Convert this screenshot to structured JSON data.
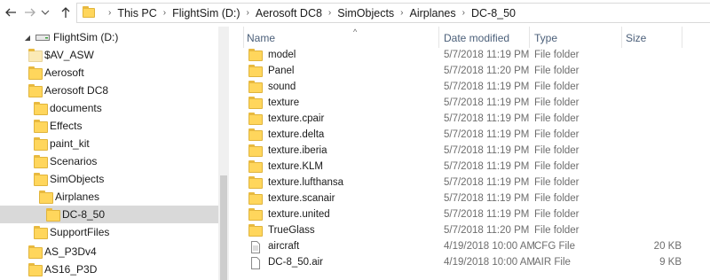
{
  "address": {
    "crumbs": [
      "This PC",
      "FlightSim (D:)",
      "Aerosoft DC8",
      "SimObjects",
      "Airplanes",
      "DC-8_50"
    ]
  },
  "tree": {
    "items": [
      {
        "label": "FlightSim (D:)",
        "icon": "drive-icon",
        "expander": "down"
      },
      {
        "label": "$AV_ASW",
        "icon": "folder-light-icon",
        "expander": ""
      },
      {
        "label": "Aerosoft",
        "icon": "folder-icon",
        "expander": ""
      },
      {
        "label": "Aerosoft DC8",
        "icon": "folder-icon",
        "expander": ""
      },
      {
        "label": "documents",
        "icon": "folder-icon",
        "expander": ""
      },
      {
        "label": "Effects",
        "icon": "folder-icon",
        "expander": ""
      },
      {
        "label": "paint_kit",
        "icon": "folder-icon",
        "expander": ""
      },
      {
        "label": "Scenarios",
        "icon": "folder-icon",
        "expander": ""
      },
      {
        "label": "SimObjects",
        "icon": "folder-icon",
        "expander": ""
      },
      {
        "label": "Airplanes",
        "icon": "folder-icon",
        "expander": ""
      },
      {
        "label": "DC-8_50",
        "icon": "folder-icon",
        "expander": "",
        "selected": true
      },
      {
        "label": "SupportFiles",
        "icon": "folder-icon",
        "expander": ""
      },
      {
        "label": "AS_P3Dv4",
        "icon": "folder-icon",
        "expander": ""
      },
      {
        "label": "AS16_P3D",
        "icon": "folder-icon",
        "expander": ""
      }
    ]
  },
  "columns": {
    "name": "Name",
    "date": "Date modified",
    "type": "Type",
    "size": "Size"
  },
  "files": [
    {
      "name": "model",
      "date": "5/7/2018 11:19 PM",
      "type": "File folder",
      "size": "",
      "icon": "folder-icon"
    },
    {
      "name": "Panel",
      "date": "5/7/2018 11:20 PM",
      "type": "File folder",
      "size": "",
      "icon": "folder-icon"
    },
    {
      "name": "sound",
      "date": "5/7/2018 11:19 PM",
      "type": "File folder",
      "size": "",
      "icon": "folder-icon"
    },
    {
      "name": "texture",
      "date": "5/7/2018 11:19 PM",
      "type": "File folder",
      "size": "",
      "icon": "folder-icon"
    },
    {
      "name": "texture.cpair",
      "date": "5/7/2018 11:19 PM",
      "type": "File folder",
      "size": "",
      "icon": "folder-icon"
    },
    {
      "name": "texture.delta",
      "date": "5/7/2018 11:19 PM",
      "type": "File folder",
      "size": "",
      "icon": "folder-icon"
    },
    {
      "name": "texture.iberia",
      "date": "5/7/2018 11:19 PM",
      "type": "File folder",
      "size": "",
      "icon": "folder-icon"
    },
    {
      "name": "texture.KLM",
      "date": "5/7/2018 11:19 PM",
      "type": "File folder",
      "size": "",
      "icon": "folder-icon"
    },
    {
      "name": "texture.lufthansa",
      "date": "5/7/2018 11:19 PM",
      "type": "File folder",
      "size": "",
      "icon": "folder-icon"
    },
    {
      "name": "texture.scanair",
      "date": "5/7/2018 11:19 PM",
      "type": "File folder",
      "size": "",
      "icon": "folder-icon"
    },
    {
      "name": "texture.united",
      "date": "5/7/2018 11:19 PM",
      "type": "File folder",
      "size": "",
      "icon": "folder-icon"
    },
    {
      "name": "TrueGlass",
      "date": "5/7/2018 11:20 PM",
      "type": "File folder",
      "size": "",
      "icon": "folder-icon"
    },
    {
      "name": "aircraft",
      "date": "4/19/2018 10:00 AM",
      "type": "CFG File",
      "size": "20 KB",
      "icon": "document-icon"
    },
    {
      "name": "DC-8_50.air",
      "date": "4/19/2018 10:00 AM",
      "type": "AIR File",
      "size": "9 KB",
      "icon": "document-icon"
    }
  ],
  "colors": {
    "selection": "#d9d9d9",
    "folder": "#ffd65c",
    "header_text": "#4c607a"
  }
}
